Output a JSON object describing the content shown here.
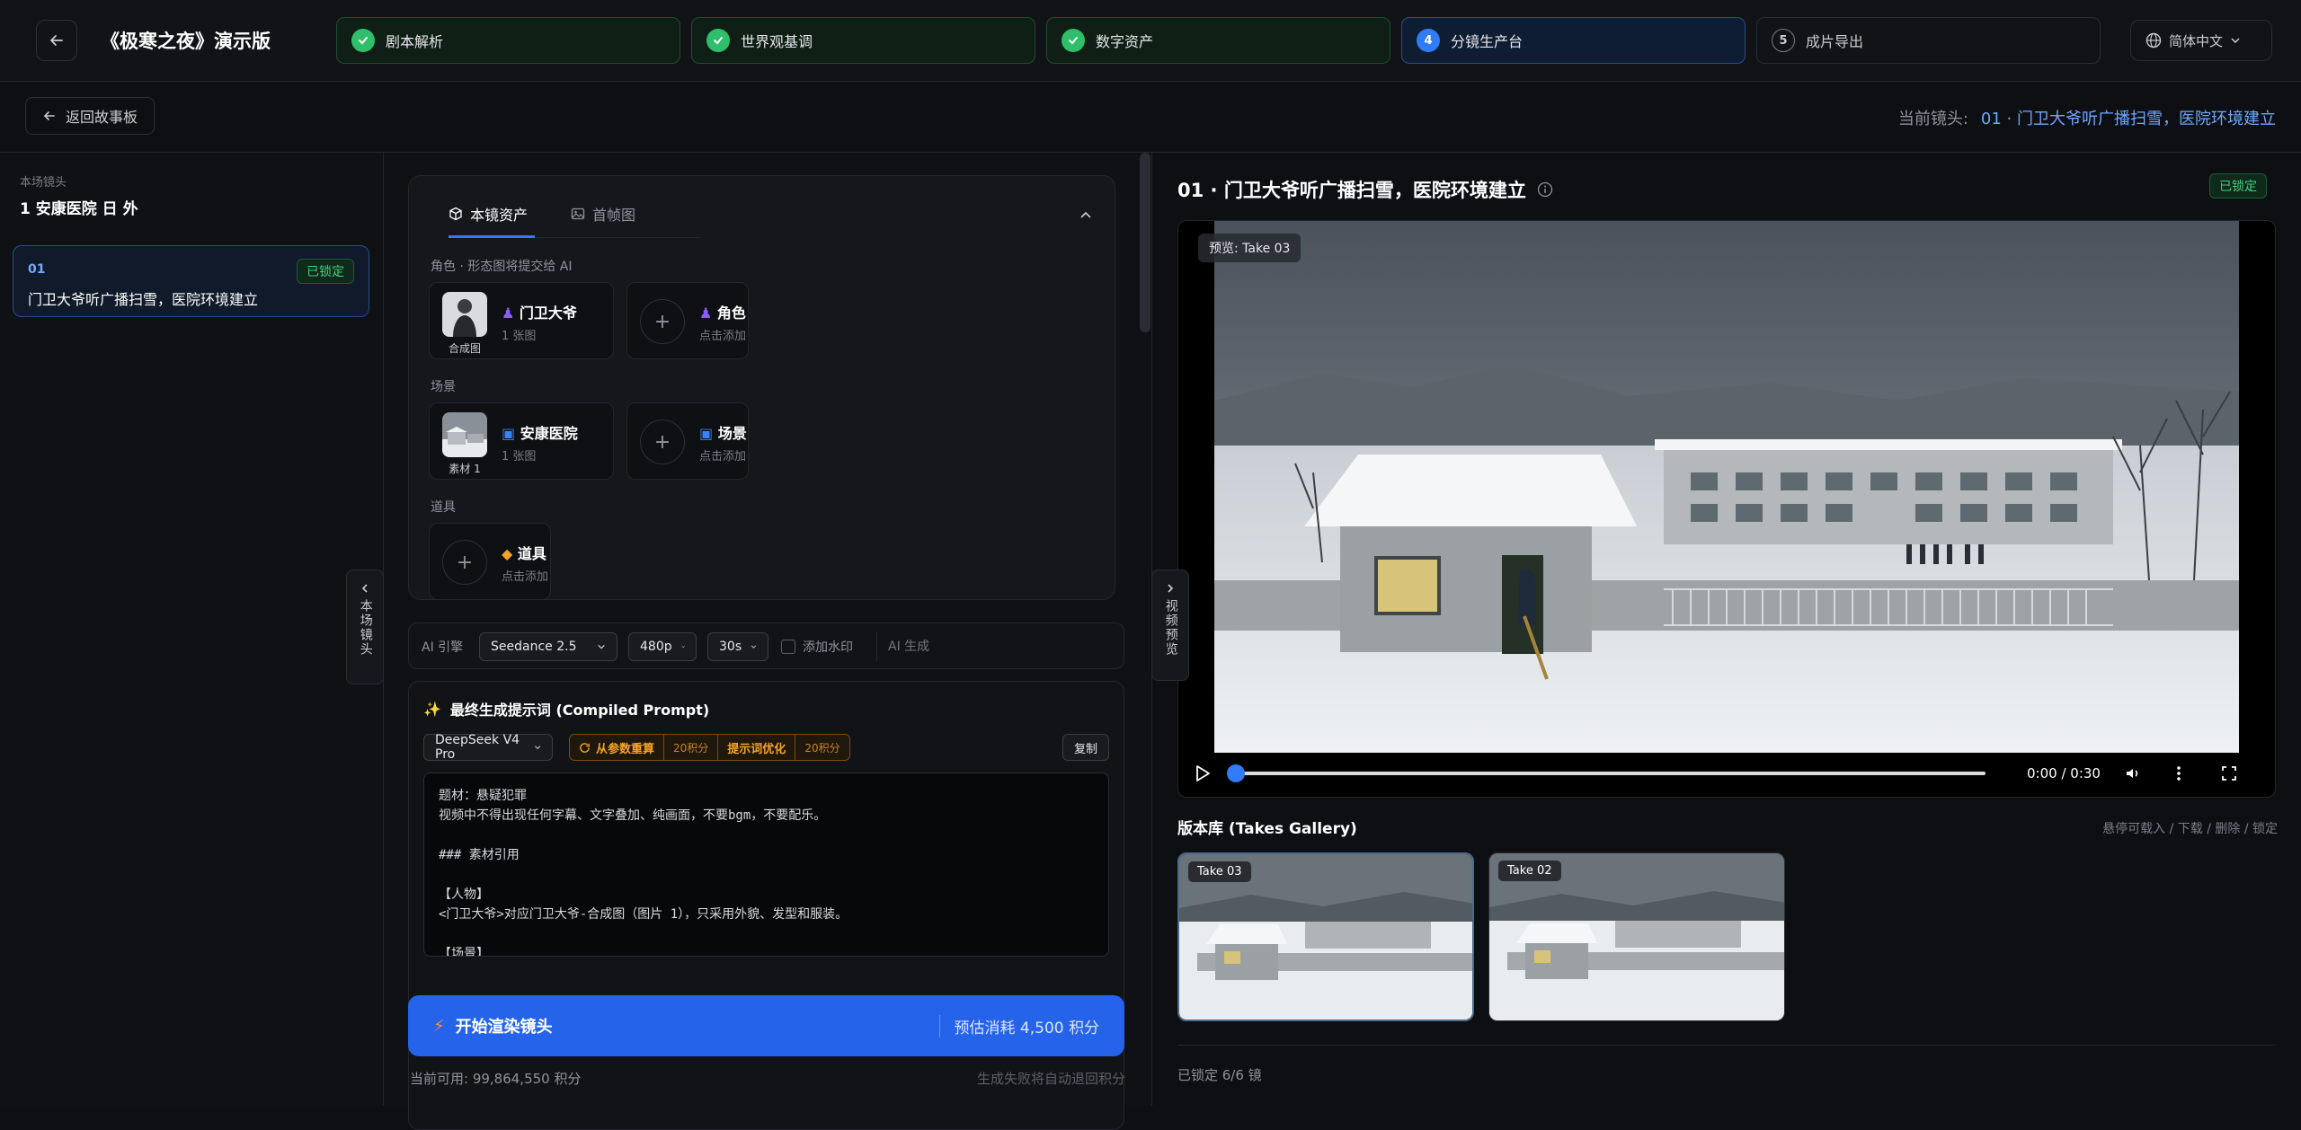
{
  "header": {
    "title": "《极寒之夜》演示版",
    "steps": [
      {
        "label": "剧本解析",
        "state": "done"
      },
      {
        "label": "世界观基调",
        "state": "done"
      },
      {
        "label": "数字资产",
        "state": "done"
      },
      {
        "label": "分镜生产台",
        "state": "active",
        "num": "4"
      },
      {
        "label": "成片导出",
        "state": "todo",
        "num": "5"
      }
    ],
    "language": "简体中文"
  },
  "subbar": {
    "back_label": "返回故事板",
    "current_shot_label": "当前镜头:",
    "current_shot_value": "01 · 门卫大爷听广播扫雪，医院环境建立"
  },
  "left": {
    "caption": "本场镜头",
    "scene": "1 安康医院 日 外",
    "shot": {
      "no": "01",
      "title": "门卫大爷听广播扫雪，医院环境建立",
      "status": "已锁定"
    },
    "collapse_tab": "本场镜头"
  },
  "assets": {
    "tab_shot": "本镜资产",
    "tab_frame": "首帧图",
    "role_caption": "角色 · 形态图将提交给 AI",
    "role_card": {
      "name": "门卫大爷",
      "sub": "1 张图",
      "thumb_caption": "合成图"
    },
    "role_add": {
      "name": "角色",
      "sub": "点击添加"
    },
    "scene_caption": "场景",
    "scene_card": {
      "name": "安康医院",
      "sub": "1 张图",
      "thumb_caption": "素材 1"
    },
    "scene_add": {
      "name": "场景",
      "sub": "点击添加"
    },
    "prop_caption": "道具",
    "prop_add": {
      "name": "道具",
      "sub": "点击添加"
    }
  },
  "engine": {
    "label": "AI 引擎",
    "model": "Seedance 2.5",
    "resolution": "480p",
    "duration": "30s",
    "watermark": "添加水印",
    "ai_generate_placeholder": "AI 生成"
  },
  "prompt": {
    "title": "最终生成提示词 (Compiled Prompt)",
    "llm": "DeepSeek V4 Pro",
    "recompute": "从参数重算",
    "recompute_cost": "20积分",
    "optimize": "提示词优化",
    "optimize_cost": "20积分",
    "copy": "复制",
    "text": "题材：悬疑犯罪\n视频中不得出现任何字幕、文字叠加、纯画面，不要bgm，不要配乐。\n\n### 素材引用\n\n【人物】\n<门卫大爷>对应门卫大爷-合成图（图片 1），只采用外貌、发型和服装。\n\n【场景】"
  },
  "render": {
    "button": "开始渲染镜头",
    "estimate": "预估消耗 4,500 积分",
    "balance": "当前可用: 99,864,550 积分",
    "refund_note": "生成失败将自动退回积分"
  },
  "preview": {
    "title": "01 · 门卫大爷听广播扫雪，医院环境建立",
    "status": "已锁定",
    "tag": "预览: Take 03",
    "time": "0:00 / 0:30",
    "collapse_tab": "视频预览",
    "progress": 0
  },
  "gallery": {
    "title": "版本库 (Takes Gallery)",
    "hint": "悬停可载入 / 下载 / 删除 / 锁定",
    "takes": [
      "Take 03",
      "Take 02"
    ],
    "footer": "已锁定 6/6 镜"
  },
  "colors": {
    "accent": "#2563eb",
    "success": "#2fbf6b",
    "warning": "#f5a524"
  }
}
